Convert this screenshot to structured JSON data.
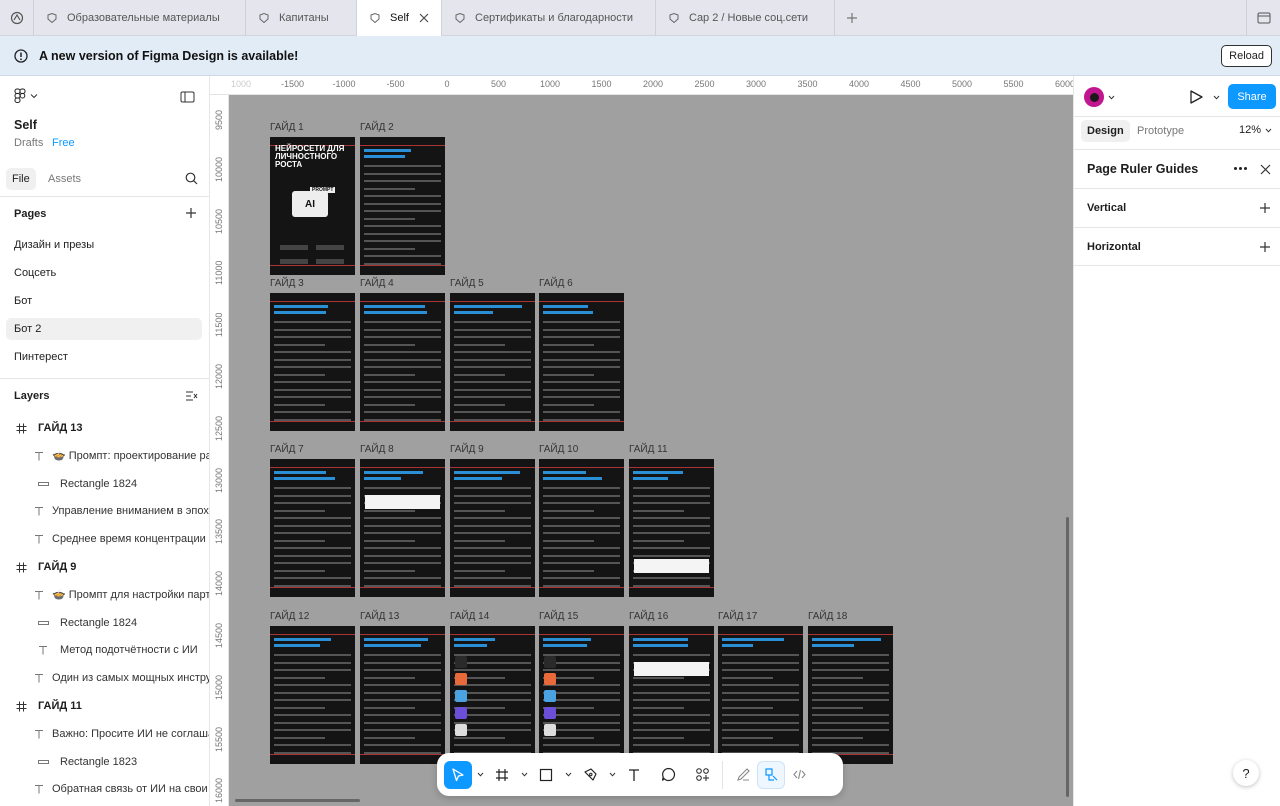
{
  "tabs": [
    {
      "label": "Образовательные материалы",
      "active": false,
      "width": 212
    },
    {
      "label": "Капитаны",
      "active": false,
      "width": 111
    },
    {
      "label": "Self",
      "active": true,
      "width": 85
    },
    {
      "label": "Сертификаты и благодарности",
      "active": false,
      "width": 214
    },
    {
      "label": "Cap 2 / Новые соц.сети",
      "active": false,
      "width": 179
    }
  ],
  "banner": {
    "text": "A new version of Figma Design is available!",
    "reload_label": "Reload"
  },
  "file": {
    "name": "Self",
    "location": "Drafts",
    "plan": "Free"
  },
  "left_tabs": {
    "file": "File",
    "assets": "Assets"
  },
  "pages": {
    "title": "Pages",
    "items": [
      "Дизайн и презы",
      "Соцсеть",
      "Бот",
      "Бот 2",
      "Пинтерест"
    ],
    "selected": "Бот 2"
  },
  "layers": {
    "title": "Layers",
    "items": [
      {
        "kind": "frame",
        "label": "ГАЙД 13"
      },
      {
        "kind": "text",
        "label": "🍲 Промпт: проектирование раб"
      },
      {
        "kind": "rect",
        "label": "Rectangle 1824"
      },
      {
        "kind": "text",
        "label": "Управление вниманием в эпоху"
      },
      {
        "kind": "text",
        "label": "Среднее время концентрации с"
      },
      {
        "kind": "frame",
        "label": "ГАЙД 9"
      },
      {
        "kind": "text",
        "label": "🍲 Промпт для настройки партн"
      },
      {
        "kind": "rect",
        "label": "Rectangle 1824"
      },
      {
        "kind": "text",
        "label": "Метод подотчётности с ИИ"
      },
      {
        "kind": "text",
        "label": "Один из самых мощных инстру"
      },
      {
        "kind": "frame",
        "label": "ГАЙД 11"
      },
      {
        "kind": "text",
        "label": "Важно: Просите ИИ не соглашат"
      },
      {
        "kind": "rect",
        "label": "Rectangle 1823"
      },
      {
        "kind": "text",
        "label": "Обратная связь от ИИ на свои р"
      }
    ]
  },
  "ruler": {
    "top": [
      "1000",
      "-1500",
      "-1000",
      "-500",
      "0",
      "500",
      "1000",
      "1500",
      "2000",
      "2500",
      "3000",
      "3500",
      "4000",
      "4500",
      "5000",
      "5500",
      "6000"
    ],
    "left": [
      "9500",
      "10000",
      "10500",
      "11000",
      "11500",
      "12000",
      "12500",
      "13000",
      "13500",
      "14000",
      "14500",
      "15000",
      "15500",
      "16000"
    ]
  },
  "guides": [
    {
      "label": "ГАЙД 1",
      "title": "НЕЙРОСЕТИ ДЛЯ ЛИЧНОСТНОГО РОСТА",
      "cover": true
    },
    {
      "label": "ГАЙД 2"
    },
    {
      "label": "ГАЙД 3"
    },
    {
      "label": "ГАЙД 4"
    },
    {
      "label": "ГАЙД 5"
    },
    {
      "label": "ГАЙД 6"
    },
    {
      "label": "ГАЙД 7"
    },
    {
      "label": "ГАЙД 8"
    },
    {
      "label": "ГАЙД 9"
    },
    {
      "label": "ГАЙД 10"
    },
    {
      "label": "ГАЙД 11"
    },
    {
      "label": "ГАЙД 12"
    },
    {
      "label": "ГАЙД 13"
    },
    {
      "label": "ГАЙД 14"
    },
    {
      "label": "ГАЙД 15"
    },
    {
      "label": "ГАЙД 16"
    },
    {
      "label": "ГАЙД 17"
    },
    {
      "label": "ГАЙД 18"
    }
  ],
  "cover_badge": "AI",
  "cover_prompt": "PROMPT",
  "right_panel": {
    "share_label": "Share",
    "tab_design": "Design",
    "tab_prototype": "Prototype",
    "zoom": "12%",
    "section_title": "Page Ruler Guides",
    "vertical": "Vertical",
    "horizontal": "Horizontal"
  },
  "help": "?",
  "colors": {
    "accent": "#0d99ff",
    "canvas": "#a0a0a0",
    "guide_bg": "#141414",
    "guide_accent": "#2b8fd6"
  }
}
